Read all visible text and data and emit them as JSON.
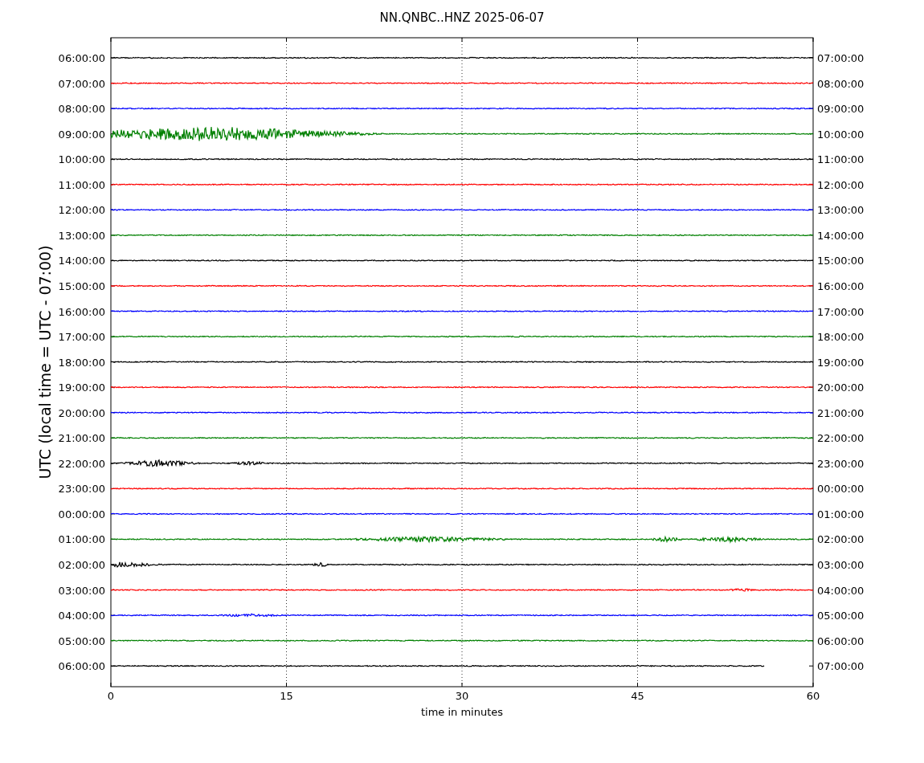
{
  "title": "NN.QNBC..HNZ 2025-06-07",
  "ylabel": "UTC (local time = UTC - 07:00)",
  "xlabel": "time in minutes",
  "xticks": [
    "0",
    "15",
    "30",
    "45",
    "60"
  ],
  "rows": [
    {
      "left": "06:00:00",
      "right": "07:00:00",
      "color": "#000000",
      "complete": true
    },
    {
      "left": "07:00:00",
      "right": "08:00:00",
      "color": "#ff0000",
      "complete": true
    },
    {
      "left": "08:00:00",
      "right": "09:00:00",
      "color": "#0000ff",
      "complete": true
    },
    {
      "left": "09:00:00",
      "right": "10:00:00",
      "color": "#008000",
      "complete": true
    },
    {
      "left": "10:00:00",
      "right": "11:00:00",
      "color": "#000000",
      "complete": true
    },
    {
      "left": "11:00:00",
      "right": "12:00:00",
      "color": "#ff0000",
      "complete": true
    },
    {
      "left": "12:00:00",
      "right": "13:00:00",
      "color": "#0000ff",
      "complete": true
    },
    {
      "left": "13:00:00",
      "right": "14:00:00",
      "color": "#008000",
      "complete": true
    },
    {
      "left": "14:00:00",
      "right": "15:00:00",
      "color": "#000000",
      "complete": true
    },
    {
      "left": "15:00:00",
      "right": "16:00:00",
      "color": "#ff0000",
      "complete": true
    },
    {
      "left": "16:00:00",
      "right": "17:00:00",
      "color": "#0000ff",
      "complete": true
    },
    {
      "left": "17:00:00",
      "right": "18:00:00",
      "color": "#008000",
      "complete": true
    },
    {
      "left": "18:00:00",
      "right": "19:00:00",
      "color": "#000000",
      "complete": true
    },
    {
      "left": "19:00:00",
      "right": "20:00:00",
      "color": "#ff0000",
      "complete": true
    },
    {
      "left": "20:00:00",
      "right": "21:00:00",
      "color": "#0000ff",
      "complete": true
    },
    {
      "left": "21:00:00",
      "right": "22:00:00",
      "color": "#008000",
      "complete": true
    },
    {
      "left": "22:00:00",
      "right": "23:00:00",
      "color": "#000000",
      "complete": true
    },
    {
      "left": "23:00:00",
      "right": "00:00:00",
      "color": "#ff0000",
      "complete": true
    },
    {
      "left": "00:00:00",
      "right": "01:00:00",
      "color": "#0000ff",
      "complete": true
    },
    {
      "left": "01:00:00",
      "right": "02:00:00",
      "color": "#008000",
      "complete": true
    },
    {
      "left": "02:00:00",
      "right": "03:00:00",
      "color": "#000000",
      "complete": true
    },
    {
      "left": "03:00:00",
      "right": "04:00:00",
      "color": "#ff0000",
      "complete": true
    },
    {
      "left": "04:00:00",
      "right": "05:00:00",
      "color": "#0000ff",
      "complete": true
    },
    {
      "left": "05:00:00",
      "right": "06:00:00",
      "color": "#008000",
      "complete": true
    },
    {
      "left": "06:00:00",
      "right": "07:00:00",
      "color": "#000000",
      "complete": false
    }
  ]
}
